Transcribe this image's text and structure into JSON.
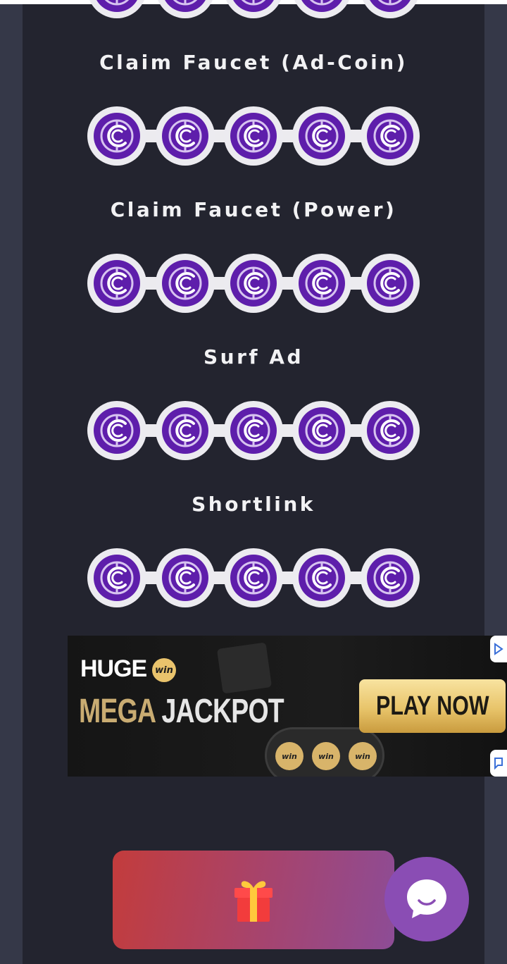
{
  "sections": [
    {
      "title": "Claim Faucet (Ad-Coin)"
    },
    {
      "title": "Claim Faucet (Power)"
    },
    {
      "title": "Surf Ad"
    },
    {
      "title": "Shortlink"
    }
  ],
  "coin_icon": "coin-c-logo-icon",
  "coins_per_row": 5,
  "ad": {
    "brand": "HUGE",
    "brand_badge": "win",
    "headline_part1": "MEGA",
    "headline_part2": "JACKPOT",
    "cta": "PLAY NOW",
    "reel_label": "win"
  },
  "gift_button": {
    "icon": "gift-icon"
  },
  "chat_button": {
    "icon": "chat-bubble-icon"
  },
  "colors": {
    "background": "#353848",
    "panel": "#23242f",
    "coin_purple": "#5e1eab",
    "gift_gradient_start": "#c33c3c",
    "gift_gradient_end": "#8d4c96",
    "chat": "#8a4db4",
    "ad_gold": "#c9ac72"
  }
}
